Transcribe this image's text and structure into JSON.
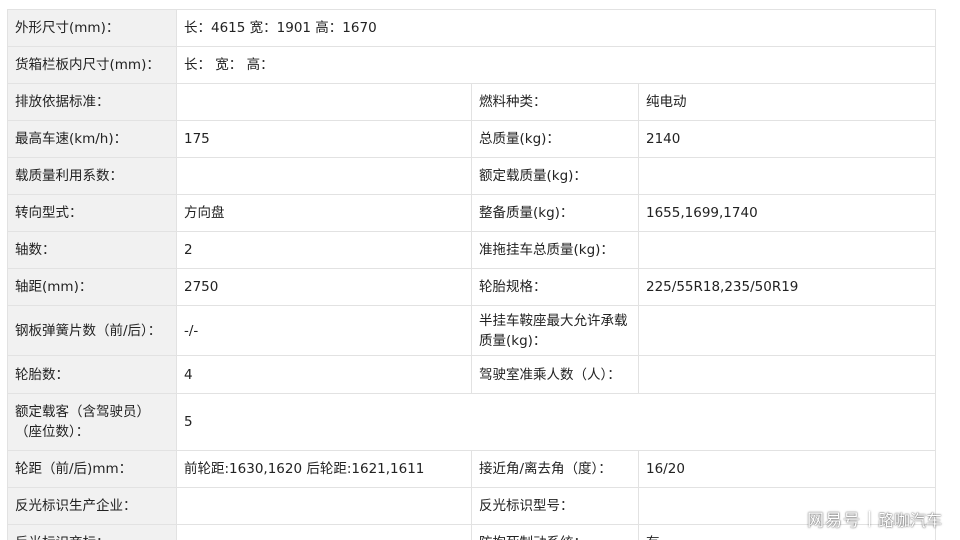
{
  "rows": [
    {
      "label": "外形尺寸(mm)：",
      "value": "长：4615 宽：1901 高：1670"
    },
    {
      "label": "货箱栏板内尺寸(mm)：",
      "value": "长： 宽： 高："
    },
    {
      "left_label": "排放依据标准：",
      "left_value": "",
      "right_label": "燃料种类：",
      "right_value": "纯电动"
    },
    {
      "left_label": "最高车速(km/h)：",
      "left_value": "175",
      "right_label": "总质量(kg)：",
      "right_value": "2140"
    },
    {
      "left_label": "载质量利用系数：",
      "left_value": "",
      "right_label": "额定载质量(kg)：",
      "right_value": ""
    },
    {
      "left_label": "转向型式：",
      "left_value": "方向盘",
      "right_label": "整备质量(kg)：",
      "right_value": "1655,1699,1740"
    },
    {
      "left_label": "轴数：",
      "left_value": "2",
      "right_label": "准拖挂车总质量(kg)：",
      "right_value": ""
    },
    {
      "left_label": "轴距(mm)：",
      "left_value": "2750",
      "right_label": "轮胎规格：",
      "right_value": "225/55R18,235/50R19"
    },
    {
      "left_label": "钢板弹簧片数（前/后）：",
      "left_value": "-/-",
      "right_label": "半挂车鞍座最大允许承载质量(kg)：",
      "right_value": ""
    },
    {
      "left_label": "轮胎数：",
      "left_value": "4",
      "right_label": "驾驶室准乘人数（人）：",
      "right_value": ""
    },
    {
      "label": "额定载客（含驾驶员）（座位数）：",
      "value": "5"
    },
    {
      "left_label": "轮距（前/后)mm：",
      "left_value": "前轮距:1630,1620 后轮距:1621,1611",
      "right_label": "接近角/离去角（度）：",
      "right_value": "16/20"
    },
    {
      "left_label": "反光标识生产企业：",
      "left_value": "",
      "right_label": "反光标识型号：",
      "right_value": ""
    },
    {
      "left_label": "反光标识商标：",
      "left_value": "",
      "right_label": "防抱死制动系统：",
      "right_value": "有"
    }
  ],
  "watermark": {
    "brand": "网易号",
    "account": "路咖汽车"
  }
}
